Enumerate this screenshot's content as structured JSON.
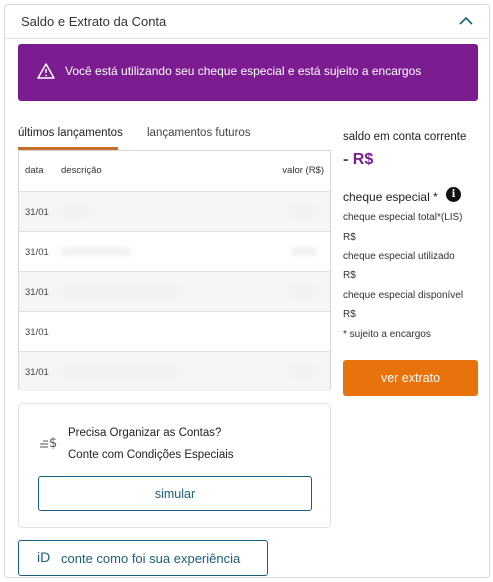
{
  "header": {
    "title": "Saldo e Extrato da Conta"
  },
  "alert": {
    "text": "Você está utilizando seu cheque especial e está sujeito a encargos",
    "color": "#7b1c91"
  },
  "tabs": [
    {
      "label": "últimos lançamentos",
      "active": true
    },
    {
      "label": "lançamentos futuros",
      "active": false
    }
  ],
  "table": {
    "columns": [
      "data",
      "descrição",
      "valor (R$)"
    ],
    "rows": [
      {
        "date": "31/01"
      },
      {
        "date": "31/01"
      },
      {
        "date": "31/01"
      },
      {
        "date": "31/01"
      },
      {
        "date": "31/01"
      }
    ]
  },
  "balance": {
    "label": "saldo em conta corrente",
    "value": "- R$"
  },
  "overdraft": {
    "title": "cheque especial *",
    "total_label": "cheque especial total*(LIS)",
    "total_value": "R$",
    "used_label": "cheque especial utilizado",
    "used_value": "R$",
    "available_label": "cheque especial disponível",
    "available_value": "R$",
    "note": "* sujeito a encargos"
  },
  "buttons": {
    "extrato": "ver extrato",
    "simular": "simular",
    "feedback": "conte como foi sua experiência"
  },
  "promo": {
    "title": "Precisa Organizar as Contas?",
    "subtitle": "Conte com Condições Especiais"
  },
  "colors": {
    "accent": "#e8730c",
    "brand_purple": "#7b1c91",
    "link_blue": "#1b5e7a"
  },
  "icons": {
    "header": "chevron-up-icon",
    "alert": "warning-icon",
    "info": "info-icon",
    "promo": "money-icon",
    "feedback": "id-icon"
  }
}
